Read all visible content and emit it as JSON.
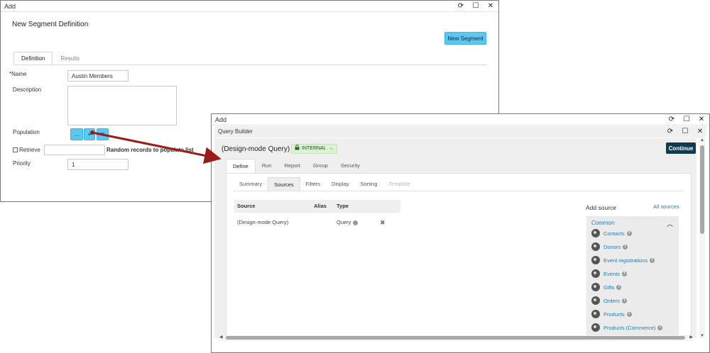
{
  "window1": {
    "title": "Add",
    "heading": "New Segment Definition",
    "new_segment_button": "New Segment",
    "tabs": [
      "Definition",
      "Results"
    ],
    "fields": {
      "name_required_marker": "*",
      "name_label": "Name",
      "name_value": "Austin Members",
      "description_label": "Description",
      "description_value": "",
      "population_label": "Population",
      "population_buttons": [
        "...",
        "+",
        "✕"
      ],
      "retrieve_label": "Retrieve",
      "retrieve_checked": false,
      "retrieve_value": "",
      "random_records_label": "Random records to populate list",
      "priority_label": "Priority",
      "priority_value": "1"
    }
  },
  "window2": {
    "title": "Add",
    "builder_title": "Query Builder",
    "query_title": "(Design-mode Query)",
    "badge": "INTERNAL",
    "continue_button": "Continue",
    "tabs": [
      "Define",
      "Run",
      "Report",
      "Group",
      "Security"
    ],
    "subtabs": [
      "Summary",
      "Sources",
      "Filters",
      "Display",
      "Sorting",
      "Template"
    ],
    "source_table": {
      "columns": [
        "Source",
        "Alias",
        "Type"
      ],
      "rows": [
        {
          "source": "(Design-mode Query)",
          "alias": "",
          "type": "Query"
        }
      ]
    },
    "add_source": {
      "label": "Add source",
      "all_sources_link": "All sources",
      "group": "Common",
      "items": [
        "Contacts",
        "Donors",
        "Event registrations",
        "Events",
        "Gifts",
        "Orders",
        "Products",
        "Products (Commerce)"
      ]
    }
  },
  "colors": {
    "accent_blue": "#5cc8f0",
    "continue_dark": "#103a50",
    "link_blue": "#1a7fbf",
    "arrow_red": "#9b1b1b",
    "badge_green": "#dcf2d2"
  },
  "icons": [
    "refresh-icon",
    "maximize-icon",
    "close-icon",
    "lock-icon",
    "arrow-right-icon",
    "info-icon",
    "remove-icon",
    "chevron-up-icon",
    "source-icon"
  ]
}
